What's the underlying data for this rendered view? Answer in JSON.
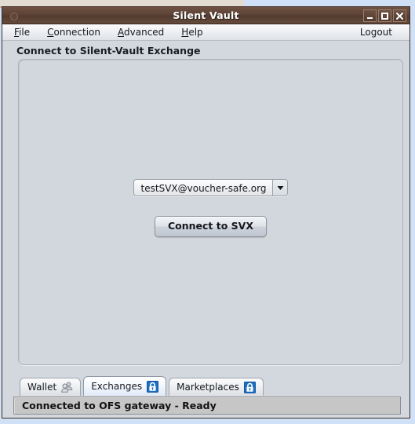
{
  "window": {
    "title": "Silent Vault",
    "controls": [
      {
        "name": "minimize",
        "glyph": "minimize-icon"
      },
      {
        "name": "maximize",
        "glyph": "maximize-icon"
      },
      {
        "name": "close",
        "glyph": "close-icon"
      }
    ],
    "system_menu_icon": "window-menu-icon"
  },
  "menu_bar": {
    "items": [
      {
        "label": "File",
        "mnemonic": "F",
        "rest": "ile"
      },
      {
        "label": "Connection",
        "mnemonic": "C",
        "rest": "onnection"
      },
      {
        "label": "Advanced",
        "mnemonic": "A",
        "rest": "dvanced"
      },
      {
        "label": "Help",
        "mnemonic": "H",
        "rest": "elp"
      }
    ],
    "logout_label": "Logout"
  },
  "panel": {
    "title": "Connect to Silent-Vault Exchange"
  },
  "exchange_selector": {
    "selected_value": "testSVX@voucher-safe.org",
    "arrow_icon": "chevron-down-icon"
  },
  "connect_button": {
    "label": "Connect to SVX"
  },
  "tabs": [
    {
      "label": "Wallet",
      "icon": "users-icon",
      "selected": false
    },
    {
      "label": "Exchanges",
      "icon": "lock-icon",
      "selected": true
    },
    {
      "label": "Marketplaces",
      "icon": "lock-icon",
      "selected": false
    }
  ],
  "status_bar": {
    "text": "Connected to OFS gateway - Ready"
  },
  "colors": {
    "titlebar_brown": "#5c4336",
    "window_face": "#d3d7de",
    "lock_blue": "#1d6fc0",
    "status_face": "#c6c6c6",
    "desktop_blue": "#cfe0f7",
    "desktop_beige": "#e3dcd2"
  }
}
